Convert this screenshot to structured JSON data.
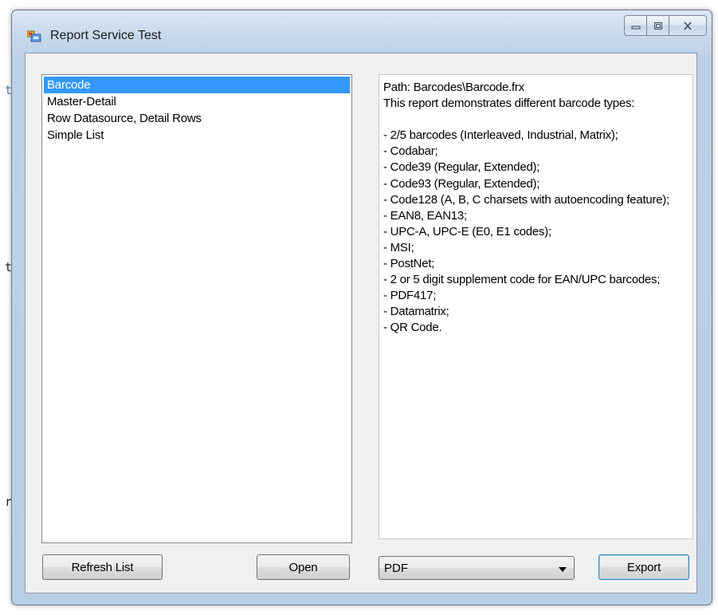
{
  "window": {
    "title": "Report Service Test"
  },
  "background": {
    "glyphs": [
      "t",
      "t",
      "r"
    ]
  },
  "reports": {
    "items": [
      {
        "label": "Barcode",
        "selected": true
      },
      {
        "label": "Master-Detail",
        "selected": false
      },
      {
        "label": "Row Datasource, Detail Rows",
        "selected": false
      },
      {
        "label": "Simple List",
        "selected": false
      }
    ]
  },
  "description": {
    "text": "Path: Barcodes\\Barcode.frx\nThis report demonstrates different barcode types:\n\n- 2/5 barcodes (Interleaved, Industrial, Matrix);\n- Codabar;\n- Code39 (Regular, Extended);\n- Code93 (Regular, Extended);\n- Code128 (A, B, C charsets with autoencoding feature);\n- EAN8, EAN13;\n- UPC-A, UPC-E (E0, E1 codes);\n- MSI;\n- PostNet;\n- 2 or 5 digit supplement code for EAN/UPC barcodes;\n- PDF417;\n- Datamatrix;\n- QR Code."
  },
  "buttons": {
    "refresh_label": "Refresh List",
    "open_label": "Open",
    "export_label": "Export"
  },
  "format": {
    "selected": "PDF"
  },
  "colors": {
    "selection": "#3399ff",
    "selection_text": "#ffffff"
  }
}
